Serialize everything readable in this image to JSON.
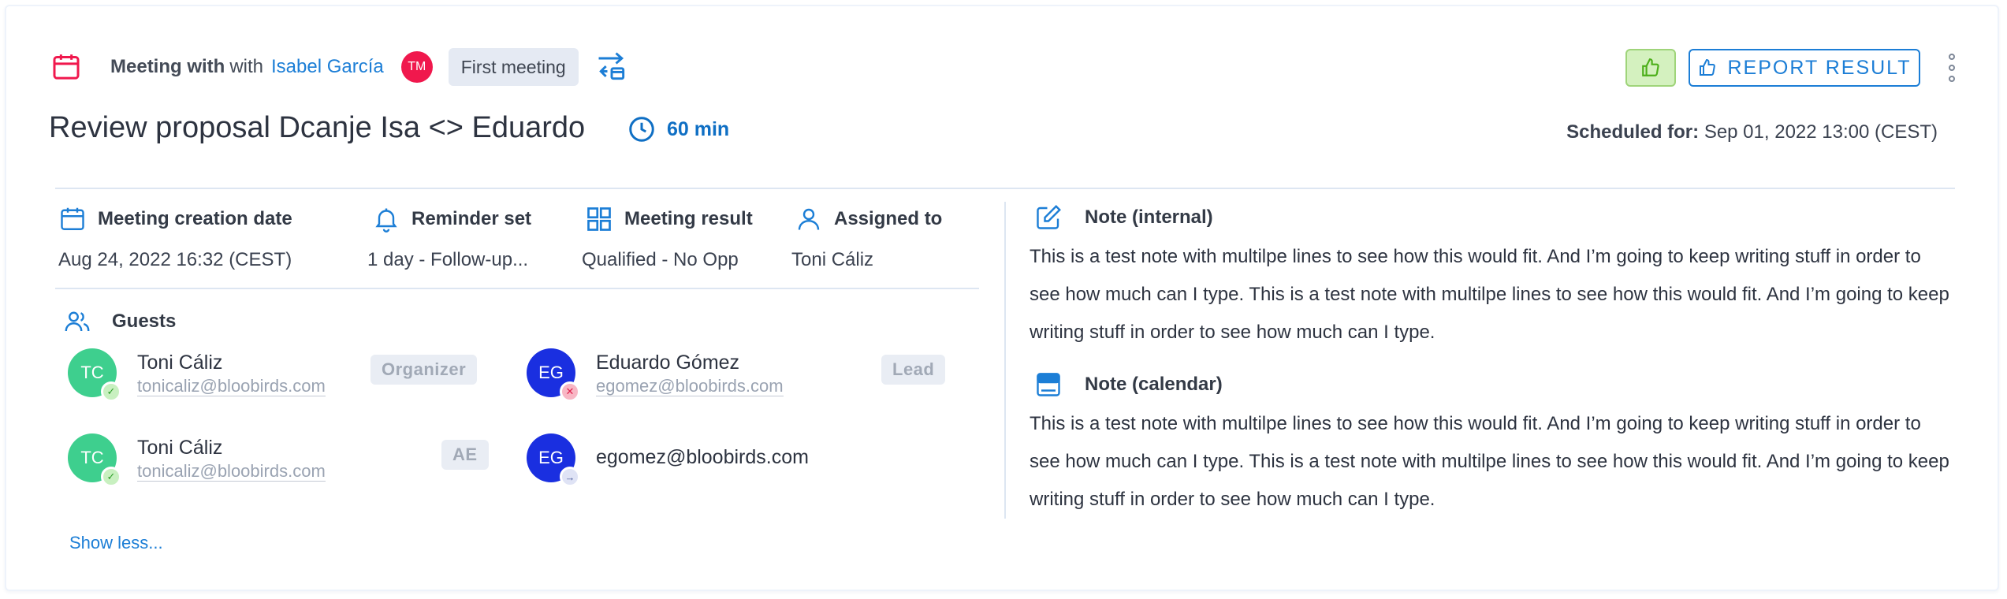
{
  "header": {
    "meeting_with": "Meeting with",
    "with_word": "with",
    "lead_name": "Isabel García",
    "owner_initials": "TM",
    "meeting_type": "First meeting",
    "title": "Review proposal Dcanje Isa <> Eduardo",
    "duration": "60 min",
    "scheduled_label": "Scheduled for:",
    "scheduled_value": "Sep 01, 2022 13:00 (CEST)",
    "report_label": "REPORT RESULT"
  },
  "info": {
    "creation_label": "Meeting creation date",
    "creation_value": "Aug 24, 2022 16:32 (CEST)",
    "reminder_label": "Reminder set",
    "reminder_value": "1 day - Follow-up...",
    "result_label": "Meeting result",
    "result_value": "Qualified - No Opp",
    "assigned_label": "Assigned to",
    "assigned_value": "Toni Cáliz"
  },
  "guests": {
    "title": "Guests",
    "show_less": "Show less...",
    "items": [
      {
        "initials": "TC",
        "name": "Toni Cáliz",
        "email": "tonicaliz@bloobirds.com",
        "role": "Organizer",
        "status": "✓"
      },
      {
        "initials": "EG",
        "name": "Eduardo Gómez",
        "email": "egomez@bloobirds.com",
        "role": "Lead",
        "status": "✕"
      },
      {
        "initials": "TC",
        "name": "Toni Cáliz",
        "email": "tonicaliz@bloobirds.com",
        "role": "AE",
        "status": "✓"
      },
      {
        "initials": "EG",
        "name": "",
        "email": "egomez@bloobirds.com",
        "role": "",
        "status": "→"
      }
    ]
  },
  "notes": {
    "internal_label": "Note (internal)",
    "internal_text": "This is a test note with multilpe lines to see how this would fit. And I’m going to keep writing stuff in order to see how much can I type. This is a test note with multilpe lines to see how this would fit. And I’m going to keep writing stuff in order to see how much can I type.",
    "calendar_label": "Note (calendar)",
    "calendar_text": "This is a test note with multilpe lines to see how this would fit. And I’m going to keep writing stuff in order to see how much can I type. This is a test note with multilpe lines to see how this would fit. And I’m going to keep writing stuff in order to see how much can I type."
  },
  "colors": {
    "accent_blue": "#1c7ed6",
    "calendar_red": "#f0184d",
    "guest_green": "#3ecf8e",
    "guest_blue": "#1a2fe0",
    "like_green": "#d4f1bf"
  }
}
